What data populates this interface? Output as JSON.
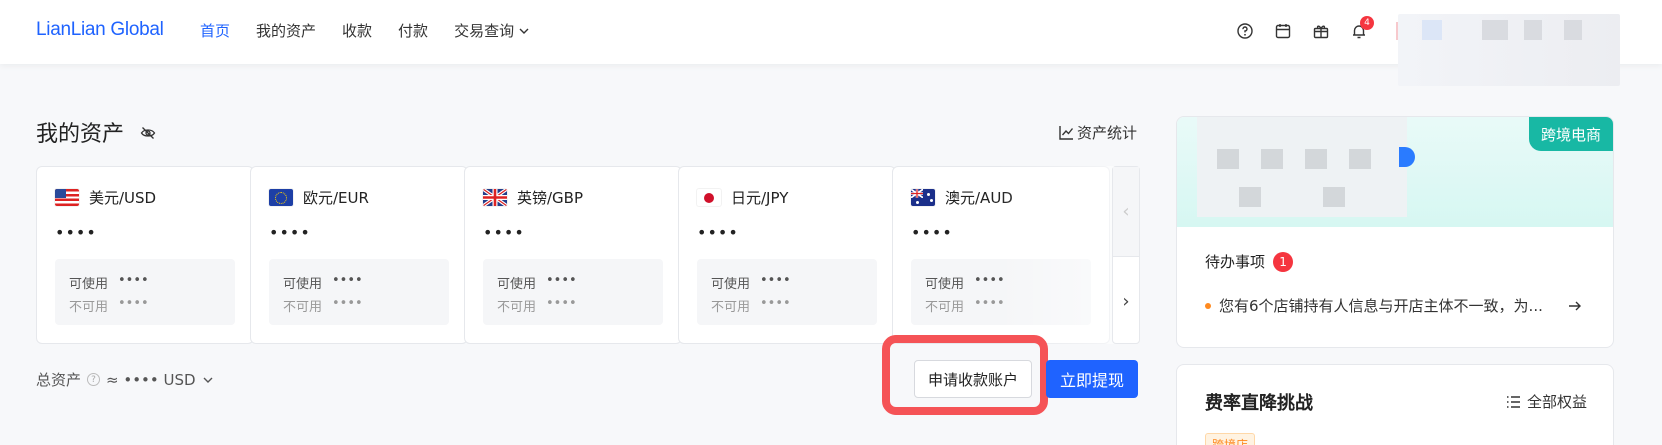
{
  "header": {
    "logo": "LianLian Global",
    "nav": {
      "home": "首页",
      "assets": "我的资产",
      "receive": "收款",
      "pay": "付款",
      "query": "交易查询"
    },
    "notification_count": "4"
  },
  "assets": {
    "title": "我的资产",
    "stats_link": "资产统计",
    "cards": [
      {
        "flag": "us",
        "currency": "美元/USD",
        "amount": "••••",
        "available_label": "可使用",
        "available": "••••",
        "unavailable_label": "不可用",
        "unavailable": "••••"
      },
      {
        "flag": "eu",
        "currency": "欧元/EUR",
        "amount": "••••",
        "available_label": "可使用",
        "available": "••••",
        "unavailable_label": "不可用",
        "unavailable": "••••"
      },
      {
        "flag": "gb",
        "currency": "英镑/GBP",
        "amount": "••••",
        "available_label": "可使用",
        "available": "••••",
        "unavailable_label": "不可用",
        "unavailable": "••••"
      },
      {
        "flag": "jp",
        "currency": "日元/JPY",
        "amount": "••••",
        "available_label": "可使用",
        "available": "••••",
        "unavailable_label": "不可用",
        "unavailable": "••••"
      },
      {
        "flag": "au",
        "currency": "澳元/AUD",
        "amount": "••••",
        "available_label": "可使用",
        "available": "••••",
        "unavailable_label": "不可用",
        "unavailable": "••••"
      }
    ],
    "total_label": "总资产",
    "total_value": "≈ •••• USD",
    "apply_button": "申请收款账户",
    "withdraw_button": "立即提现"
  },
  "right_panel": {
    "tag": "跨境电商",
    "todo_title": "待办事项",
    "todo_count": "1",
    "todo_item": "您有6个店铺持有人信息与开店主体不一致，为..."
  },
  "promo": {
    "title": "费率直降挑战",
    "link": "全部权益",
    "tag": "跨境店"
  },
  "colors": {
    "brand": "#1f63ff",
    "highlight": "#f55356",
    "teal": "#18b8a4",
    "badge": "#f5353f"
  }
}
